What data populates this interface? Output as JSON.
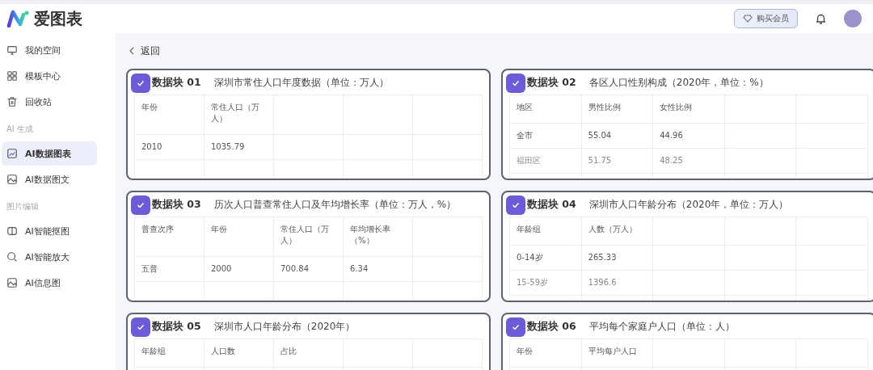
{
  "app": {
    "logo": "爱图表"
  },
  "header": {
    "buy_button": "购买会员"
  },
  "sidebar": {
    "groups": [
      {
        "items": [
          {
            "label": "我的空间",
            "selected": false
          },
          {
            "label": "模板中心",
            "selected": false
          },
          {
            "label": "回收站",
            "selected": false
          }
        ]
      },
      {
        "title": "AI 生成",
        "items": [
          {
            "label": "AI数据图表",
            "selected": true
          },
          {
            "label": "AI数据图文",
            "selected": false
          }
        ]
      },
      {
        "title": "图片编辑",
        "items": [
          {
            "label": "AI智能抠图",
            "selected": false
          },
          {
            "label": "AI智能放大",
            "selected": false
          },
          {
            "label": "AI信息图",
            "selected": false
          }
        ]
      }
    ]
  },
  "back": {
    "label": "返回"
  },
  "blocks": [
    {
      "checked": true,
      "label": "数据块 01",
      "title": "深圳市常住人口年度数据（单位：万人）",
      "columns": [
        "年份",
        "常住人口（万人）"
      ],
      "rows": [
        {
          "cells": [
            "2010",
            "1035.79"
          ],
          "faded": false
        }
      ]
    },
    {
      "checked": true,
      "label": "数据块 02",
      "title": "各区人口性别构成（2020年，单位：%）",
      "columns": [
        "地区",
        "男性比例",
        "女性比例"
      ],
      "rows": [
        {
          "cells": [
            "全市",
            "55.04",
            "44.96"
          ],
          "faded": false
        },
        {
          "cells": [
            "福田区",
            "51.75",
            "48.25"
          ],
          "faded": true
        }
      ]
    },
    {
      "checked": true,
      "label": "数据块 03",
      "title": "历次人口普查常住人口及年均增长率（单位：万人，%）",
      "columns": [
        "普查次序",
        "年份",
        "常住人口（万人）",
        "年均增长率（%）"
      ],
      "rows": [
        {
          "cells": [
            "五普",
            "2000",
            "700.84",
            "6.34"
          ],
          "faded": false
        }
      ]
    },
    {
      "checked": true,
      "label": "数据块 04",
      "title": "深圳市人口年龄分布（2020年，单位：万人）",
      "columns": [
        "年龄组",
        "人数（万人）"
      ],
      "rows": [
        {
          "cells": [
            "0-14岁",
            "265.33"
          ],
          "faded": false
        },
        {
          "cells": [
            "15-59岁",
            "1396.6"
          ],
          "faded": true
        }
      ]
    },
    {
      "checked": true,
      "label": "数据块 05",
      "title": "深圳市人口年龄分布（2020年）",
      "columns": [
        "年龄组",
        "人口数",
        "占比"
      ]
    },
    {
      "checked": true,
      "label": "数据块 06",
      "title": "平均每个家庭户人口（单位：人）",
      "columns": [
        "年份",
        "平均每户人口"
      ]
    }
  ]
}
